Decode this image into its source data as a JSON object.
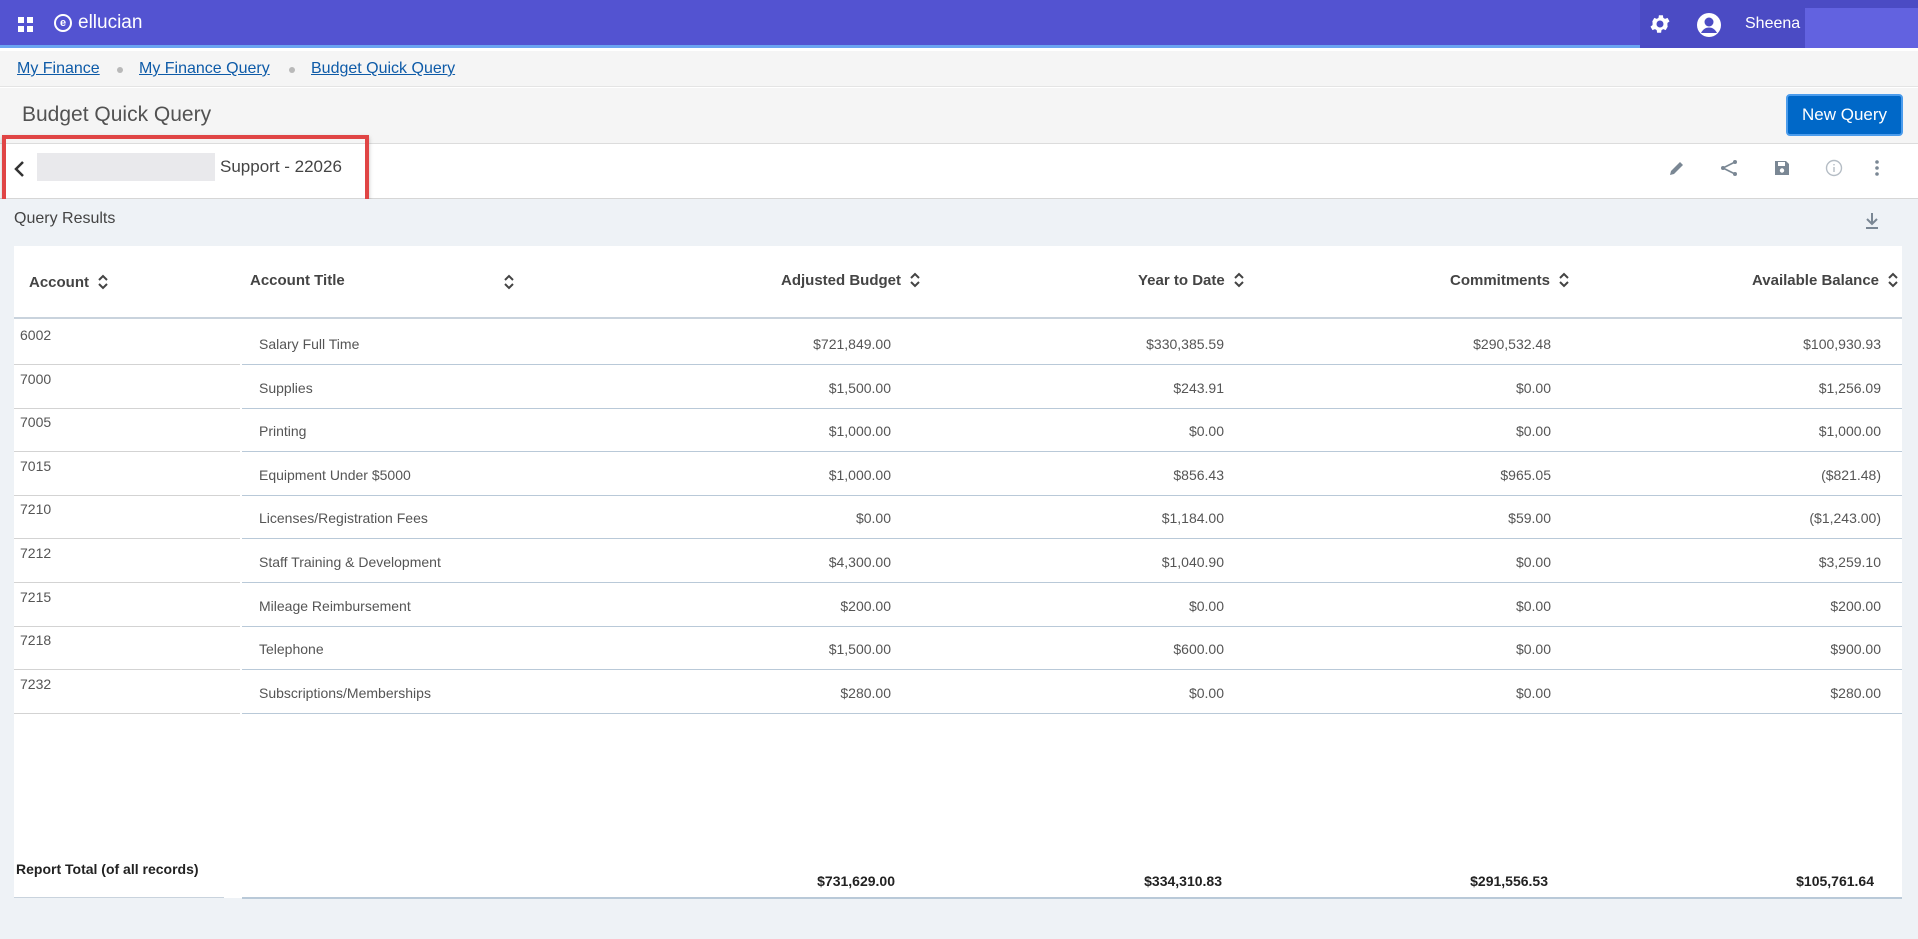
{
  "topbar": {
    "brand": "ellucian",
    "username": "Sheena",
    "icons": [
      "apps-grid-icon",
      "gear-icon",
      "user-icon"
    ]
  },
  "breadcrumbs": [
    {
      "label": "My Finance"
    },
    {
      "label": "My Finance Query"
    },
    {
      "label": "Budget Quick Query"
    }
  ],
  "page": {
    "title": "Budget Quick Query",
    "new_query_label": "New Query"
  },
  "query": {
    "name": "Support - 22026",
    "actions": [
      "edit-icon",
      "share-icon",
      "save-icon",
      "info-icon",
      "more-vertical-icon"
    ]
  },
  "results": {
    "title": "Query Results",
    "columns": {
      "account": "Account",
      "account_title": "Account Title",
      "adjusted_budget": "Adjusted Budget",
      "year_to_date": "Year to Date",
      "commitments": "Commitments",
      "available_balance": "Available Balance"
    },
    "rows": [
      {
        "account": "6002",
        "title": "Salary Full Time",
        "budget": "$721,849.00",
        "ytd": "$330,385.59",
        "commitments": "$290,532.48",
        "available": "$100,930.93"
      },
      {
        "account": "7000",
        "title": "Supplies",
        "budget": "$1,500.00",
        "ytd": "$243.91",
        "commitments": "$0.00",
        "available": "$1,256.09"
      },
      {
        "account": "7005",
        "title": "Printing",
        "budget": "$1,000.00",
        "ytd": "$0.00",
        "commitments": "$0.00",
        "available": "$1,000.00"
      },
      {
        "account": "7015",
        "title": "Equipment Under $5000",
        "budget": "$1,000.00",
        "ytd": "$856.43",
        "commitments": "$965.05",
        "available": "($821.48)"
      },
      {
        "account": "7210",
        "title": "Licenses/Registration Fees",
        "budget": "$0.00",
        "ytd": "$1,184.00",
        "commitments": "$59.00",
        "available": "($1,243.00)"
      },
      {
        "account": "7212",
        "title": "Staff Training & Development",
        "budget": "$4,300.00",
        "ytd": "$1,040.90",
        "commitments": "$0.00",
        "available": "$3,259.10"
      },
      {
        "account": "7215",
        "title": "Mileage Reimbursement",
        "budget": "$200.00",
        "ytd": "$0.00",
        "commitments": "$0.00",
        "available": "$200.00"
      },
      {
        "account": "7218",
        "title": "Telephone",
        "budget": "$1,500.00",
        "ytd": "$600.00",
        "commitments": "$0.00",
        "available": "$900.00"
      },
      {
        "account": "7232",
        "title": "Subscriptions/Memberships",
        "budget": "$280.00",
        "ytd": "$0.00",
        "commitments": "$0.00",
        "available": "$280.00"
      }
    ],
    "total": {
      "label": "Report Total (of all records)",
      "budget": "$731,629.00",
      "ytd": "$334,310.83",
      "commitments": "$291,556.53",
      "available": "$105,761.64"
    }
  },
  "colors": {
    "topbar": "#5353d1",
    "accent_line": "#6aa4f1",
    "primary_button": "#0068c8",
    "link": "#0e5ba8",
    "highlight": "#e04545"
  }
}
